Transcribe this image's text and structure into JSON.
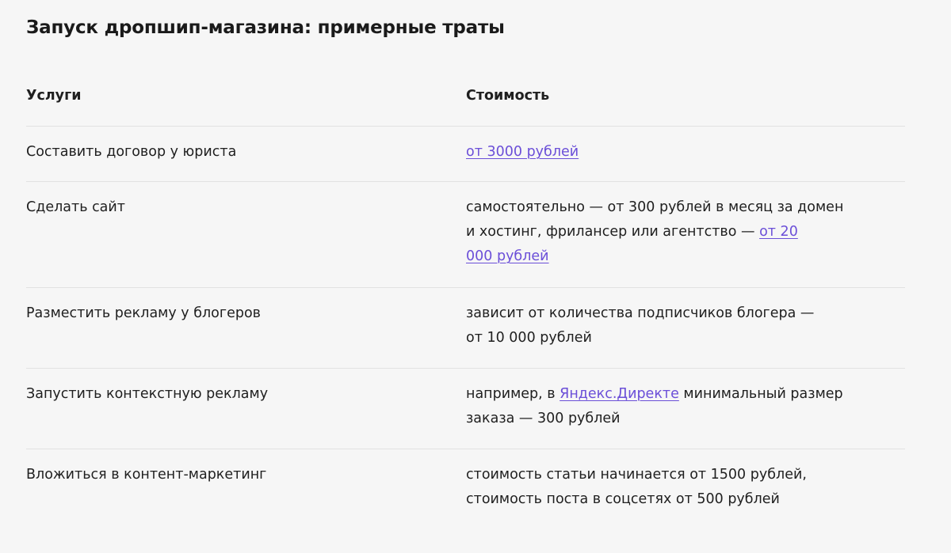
{
  "title": "Запуск дропшип-магазина: примерные траты",
  "table": {
    "headers": [
      "Услуги",
      "Стоимость"
    ],
    "rows": [
      {
        "service": "Составить договор у юриста",
        "cost_link": "от 3000 рублей"
      },
      {
        "service": "Сделать сайт",
        "cost_line1": "самостоятельно — от 300 рублей в месяц за домен",
        "cost_line2_pre": "и хостинг, фрилансер или агентство — ",
        "cost_link_a": "от 20",
        "cost_link_b": "000 рублей"
      },
      {
        "service": "Разместить рекламу у блогеров",
        "cost_line1": "зависит от количества подписчиков блогера —",
        "cost_line2": "от 10 000 рублей"
      },
      {
        "service": "Запустить контекстную рекламу",
        "cost_pre": "например, в ",
        "cost_link": "Яндекс.Директе",
        "cost_post": " минимальный размер",
        "cost_line2": "заказа — 300 рублей"
      },
      {
        "service": "Вложиться в контент-маркетинг",
        "cost_line1": "стоимость статьи начинается от 1500 рублей,",
        "cost_line2": "стоимость поста в соцсетях от 500 рублей"
      }
    ]
  },
  "colors": {
    "background": "#f6f6f6",
    "link": "#6b4fd8",
    "divider": "#e2e2e2"
  }
}
